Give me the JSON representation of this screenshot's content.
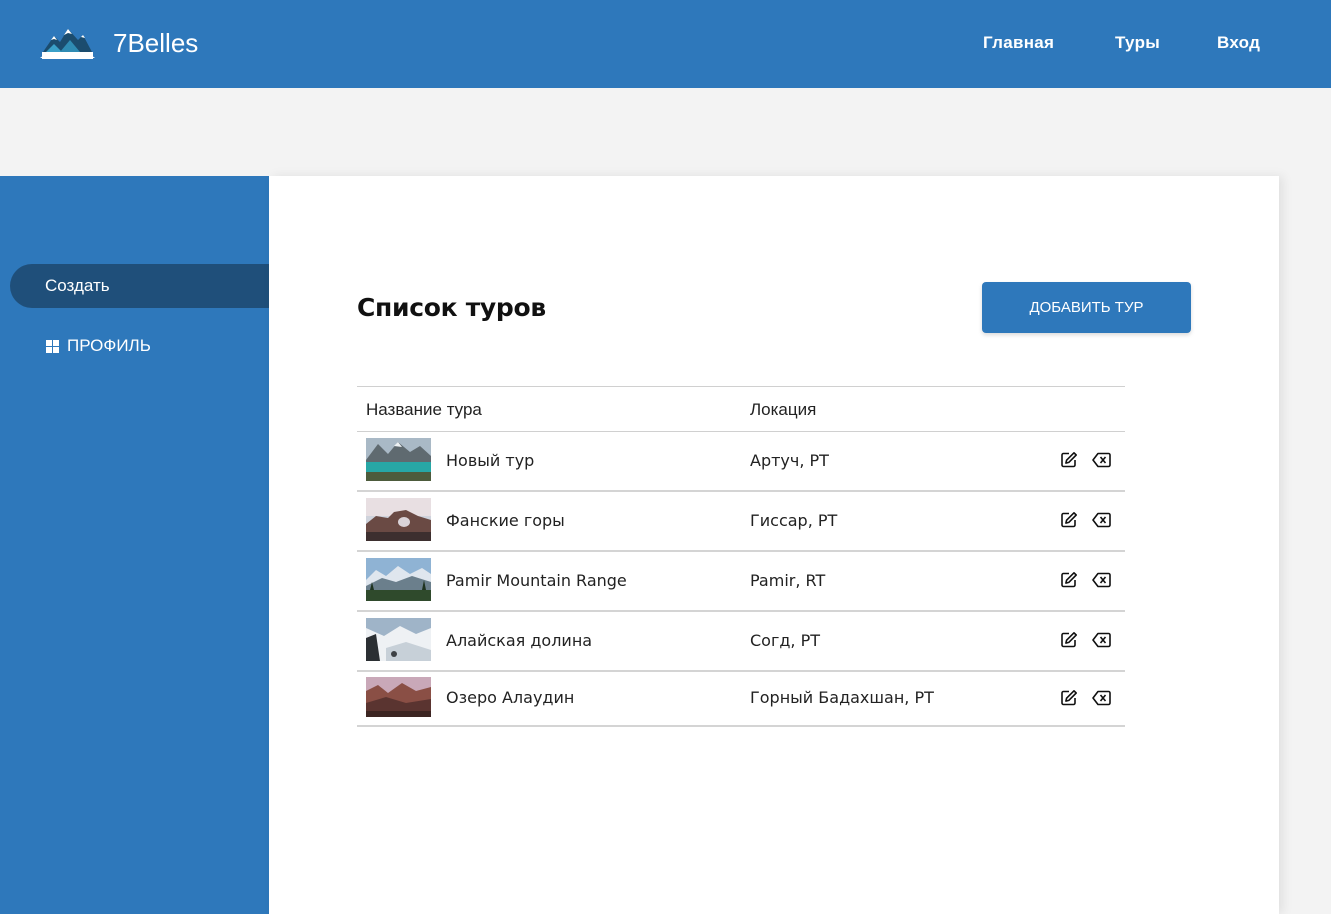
{
  "header": {
    "brand": "7Belles",
    "nav": [
      "Главная",
      "Туры",
      "Вход"
    ]
  },
  "sidebar": {
    "items": [
      {
        "label": "Создать",
        "active": true
      },
      {
        "label": "ПРОФИЛЬ",
        "icon": "dashboard-icon"
      }
    ]
  },
  "main": {
    "title": "Список туров",
    "add_button": "ДОБАВИТЬ ТУР",
    "table": {
      "columns": [
        "Название тура",
        "Локация"
      ],
      "rows": [
        {
          "name": "Новый тур",
          "location": "Артуч, РТ"
        },
        {
          "name": "Фанские горы",
          "location": "Гиссар, РТ"
        },
        {
          "name": "Pamir Mountain Range",
          "location": "Pamir, RT"
        },
        {
          "name": "Алайская долина",
          "location": "Согд, РТ"
        },
        {
          "name": "Озеро Алаудин",
          "location": "Горный Бадахшан, РТ"
        }
      ],
      "row_actions": [
        "edit-icon",
        "delete-icon"
      ]
    }
  },
  "colors": {
    "primary": "#2e78bb",
    "sidebar_active": "#1f4f7a",
    "page_background": "#f3f3f3"
  }
}
